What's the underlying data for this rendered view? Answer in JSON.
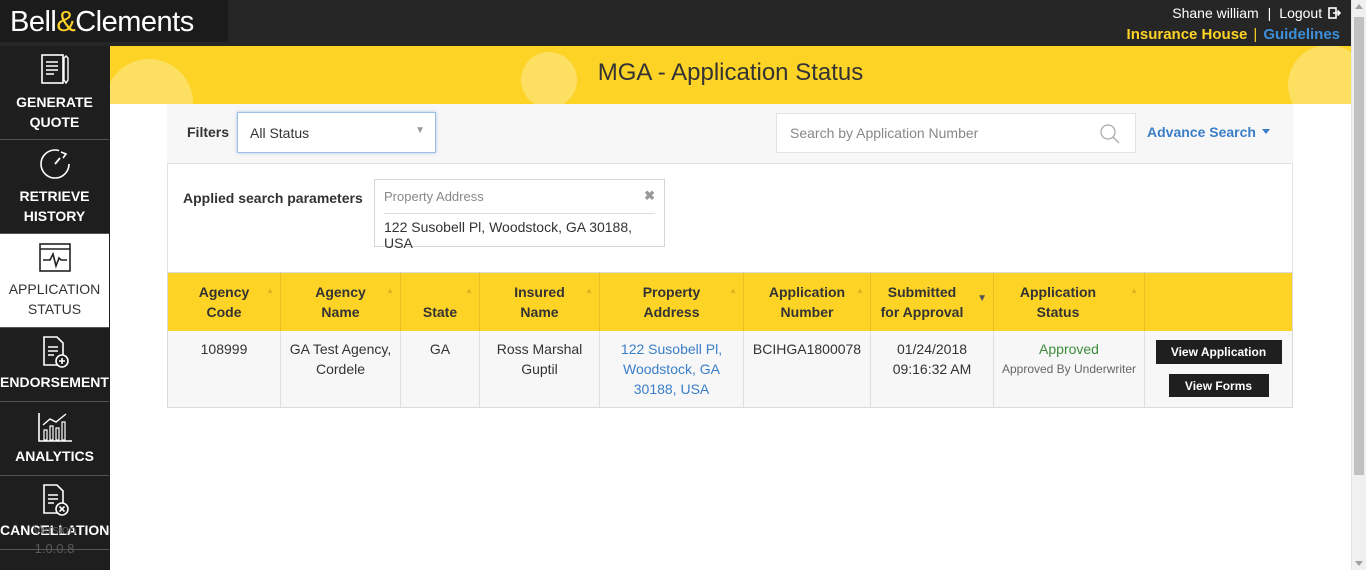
{
  "header": {
    "logo_left": "Bell",
    "logo_amp": "&",
    "logo_right": "Clements",
    "user_name": "Shane william",
    "separator": "|",
    "logout": "Logout",
    "org_name": "Insurance House",
    "guidelines": "Guidelines"
  },
  "sidebar": {
    "items": [
      {
        "line1": "GENERATE",
        "line2": "QUOTE",
        "icon": "document-pen-icon"
      },
      {
        "line1": "RETRIEVE",
        "line2": "HISTORY",
        "icon": "history-clock-icon"
      },
      {
        "line1": "APPLICATION",
        "line2": "STATUS",
        "icon": "status-monitor-icon"
      },
      {
        "line1": "ENDORSEMENT",
        "line2": "",
        "icon": "document-plus-icon"
      },
      {
        "line1": "ANALYTICS",
        "line2": "",
        "icon": "bar-chart-icon"
      },
      {
        "line1": "CANCELLATION",
        "line2": "",
        "icon": "document-cancel-icon"
      }
    ],
    "version_label": "Version",
    "version_number": "1.0.0.8"
  },
  "page": {
    "title": "MGA - Application Status"
  },
  "filters": {
    "label": "Filters",
    "status_value": "All Status",
    "search_placeholder": "Search by Application Number",
    "advance_search": "Advance Search"
  },
  "applied": {
    "label": "Applied search parameters",
    "param_key": "Property Address",
    "param_value": "122 Susobell Pl, Woodstock, GA 30188, USA"
  },
  "table": {
    "headers": [
      {
        "l1": "Agency",
        "l2": "Code"
      },
      {
        "l1": "Agency",
        "l2": "Name"
      },
      {
        "l1": "",
        "l2": "State"
      },
      {
        "l1": "Insured",
        "l2": "Name"
      },
      {
        "l1": "Property",
        "l2": "Address"
      },
      {
        "l1": "Application",
        "l2": "Number"
      },
      {
        "l1": "Submitted",
        "l2": "for Approval"
      },
      {
        "l1": "Application",
        "l2": "Status"
      }
    ],
    "rows": [
      {
        "agency_code": "108999",
        "agency_name_1": "GA Test Agency,",
        "agency_name_2": "Cordele",
        "state": "GA",
        "insured_1": "Ross Marshal",
        "insured_2": "Guptil",
        "addr_1": "122 Susobell Pl,",
        "addr_2": "Woodstock, GA",
        "addr_3": "30188, USA",
        "app_number": "BCIHGA1800078",
        "submitted_date": "01/24/2018",
        "submitted_time": "09:16:32 AM",
        "status": "Approved",
        "status_sub": "Approved By Underwriter",
        "view_application": "View Application",
        "view_forms": "View Forms"
      }
    ]
  },
  "colors": {
    "brand_yellow": "#fdd326",
    "dark": "#1e1e1e",
    "link_blue": "#3a7ec8",
    "approved_green": "#3c8d3c"
  }
}
